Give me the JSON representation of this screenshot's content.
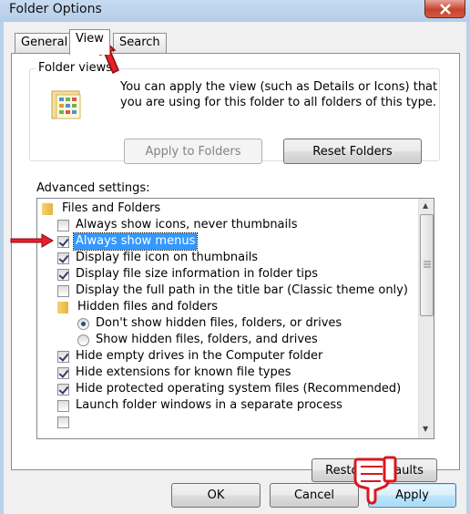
{
  "window": {
    "title": "Folder Options"
  },
  "tabs": [
    {
      "label": "General"
    },
    {
      "label": "View"
    },
    {
      "label": "Search"
    }
  ],
  "folder_views": {
    "label": "Folder views",
    "description": "You can apply the view (such as Details or Icons) that you are using for this folder to all folders of this type.",
    "apply_label": "Apply to Folders",
    "reset_label": "Reset Folders"
  },
  "advanced": {
    "label": "Advanced settings:",
    "items": [
      {
        "type": "folder",
        "label": "Files and Folders"
      },
      {
        "type": "checkbox",
        "checked": false,
        "label": "Always show icons, never thumbnails"
      },
      {
        "type": "checkbox",
        "checked": true,
        "label": "Always show menus"
      },
      {
        "type": "checkbox",
        "checked": true,
        "label": "Display file icon on thumbnails"
      },
      {
        "type": "checkbox",
        "checked": true,
        "label": "Display file size information in folder tips"
      },
      {
        "type": "checkbox",
        "checked": false,
        "label": "Display the full path in the title bar (Classic theme only)"
      },
      {
        "type": "folder",
        "label": "Hidden files and folders"
      },
      {
        "type": "radio",
        "checked": true,
        "label": "Don't show hidden files, folders, or drives"
      },
      {
        "type": "radio",
        "checked": false,
        "label": "Show hidden files, folders, and drives"
      },
      {
        "type": "checkbox",
        "checked": true,
        "label": "Hide empty drives in the Computer folder"
      },
      {
        "type": "checkbox",
        "checked": true,
        "label": "Hide extensions for known file types"
      },
      {
        "type": "checkbox",
        "checked": true,
        "label": "Hide protected operating system files (Recommended)"
      },
      {
        "type": "checkbox",
        "checked": false,
        "label": "Launch folder windows in a separate process"
      }
    ],
    "restore_label": "Restore Defaults"
  },
  "footer": {
    "ok_label": "OK",
    "cancel_label": "Cancel",
    "apply_label": "Apply"
  },
  "colors": {
    "selection": "#3399ff",
    "annotation_red": "#e8202a",
    "title_bar": "#b9d1ea"
  }
}
